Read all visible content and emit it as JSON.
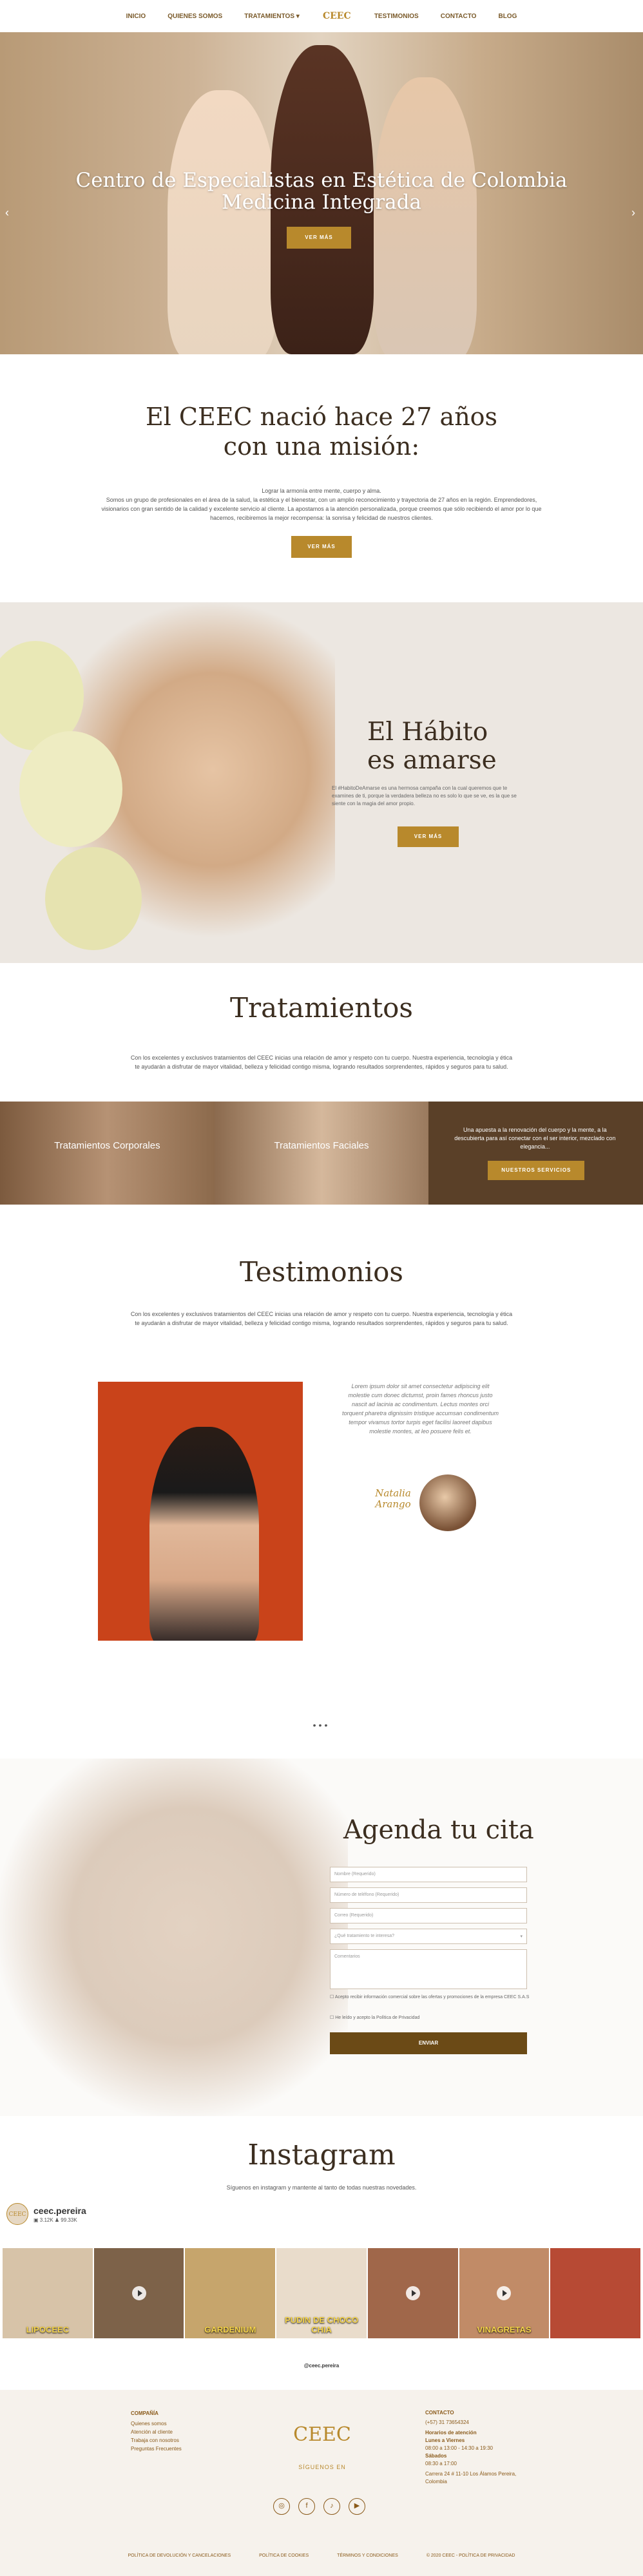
{
  "nav": {
    "items": [
      "INICIO",
      "QUIENES SOMOS",
      "TRATAMIENTOS",
      "TESTIMONIOS",
      "CONTACTO",
      "BLOG"
    ],
    "logo": "CEEC"
  },
  "hero": {
    "title_line1": "Centro de Especialistas en Estética de Colombia",
    "title_line2": "Medicina Integrada",
    "button": "VER MÁS"
  },
  "mission": {
    "title_line1": "El CEEC nació hace 27 años",
    "title_line2": "con una misión:",
    "p1": "Lograr la armonía entre mente, cuerpo y alma.",
    "p2": "Somos un grupo de profesionales en el área de la salud, la estética y el bienestar, con un amplio reconocimiento y trayectoria de 27 años en la región. Emprendedores, visionarios con gran sentido de la calidad y excelente servicio al cliente. La apostamos a la atención personalizada, porque creemos que sólo recibiendo el amor por lo que hacemos, recibiremos la mejor recompensa: la sonrisa y felicidad de nuestros clientes.",
    "button": "VER MÁS"
  },
  "habito": {
    "title_line1": "El Hábito",
    "title_line2": "es amarse",
    "text": "El #HabitoDeAmarse es una hermosa campaña con la cual queremos que te examines de ti, porque la verdadera belleza no es solo lo que se ve, es la que se siente con la magia del amor propio.",
    "button": "VER MÁS"
  },
  "tratamientos": {
    "title": "Tratamientos",
    "text": "Con los excelentes y exclusivos tratamientos del CEEC inicias una relación de amor y respeto con tu cuerpo. Nuestra experiencia, tecnología y ética te ayudarán a disfrutar de mayor vitalidad, belleza y felicidad contigo misma, logrando resultados sorprendentes, rápidos y seguros para tu salud.",
    "card1": "Tratamientos Corporales",
    "card2": "Tratamientos Faciales",
    "card3": "Una apuesta a la renovación del cuerpo y la mente, a la descubierta para así conectar con el ser interior, mezclado con elegancia...",
    "card3_button": "NUESTROS SERVICIOS"
  },
  "testimonios": {
    "title": "Testimonios",
    "text": "Con los excelentes y exclusivos tratamientos del CEEC inicias una relación de amor y respeto con tu cuerpo. Nuestra experiencia, tecnología y ética te ayudarán a disfrutar de mayor vitalidad, belleza y felicidad contigo misma, logrando resultados sorprendentes, rápidos y seguros para tu salud.",
    "quote": "Lorem ipsum dolor sit amet consectetur adipiscing elit molestie cum donec dictumst, proin fames rhoncus justo nascit ad lacinia ac condimentum. Lectus montes orci torquent pharetra dignissim tristique accumsan condimentum tempor vivamus tortor turpis eget facilisi laoreet dapibus molestie montes, at leo posuere felis et.",
    "name_line1": "Natalia",
    "name_line2": "Arango"
  },
  "agenda": {
    "title": "Agenda tu cita",
    "f1": "Nombre (Requerido)",
    "f2": "Número de teléfono (Requerido)",
    "f3": "Correo (Requerido)",
    "f4": "¿Qué tratamiento te interesa?",
    "f5": "Comentarios",
    "c1": "Acepto recibir información comercial sobre las ofertas y promociones de la empresa CEEC S.A.S",
    "c2": "He leído y acepto la Política de Privacidad",
    "button": "ENVIAR"
  },
  "instagram": {
    "title": "Instagram",
    "subtitle": "Síguenos en instagram y mantente al tanto de todas nuestras novedades.",
    "profile_name": "ceec.pereira",
    "stats": "▣ 3.12K   ♟ 99.33K",
    "handle": "@ceec.pereira",
    "tiles": [
      {
        "label": "LIPOCEEC",
        "color": "#d7c3a8"
      },
      {
        "label": "",
        "color": "#7d6249"
      },
      {
        "label": "GARDENIUM",
        "color": "#c6a56c"
      },
      {
        "label": "PUDIN DE CHOCO CHIA",
        "color": "#e9dccb"
      },
      {
        "label": "",
        "color": "#a0674a"
      },
      {
        "label": "VINAGRETAS",
        "color": "#c18b67"
      },
      {
        "label": "",
        "color": "#b74a34"
      }
    ]
  },
  "footer": {
    "company_heading": "COMPAÑÍA",
    "company_links": [
      "Quienes somos",
      "Atención al cliente",
      "Trabaja con nosotros",
      "Preguntas Frecuentes"
    ],
    "logo": "CEEC",
    "logo_sub": "SÍGUENOS EN",
    "contact_heading": "CONTACTO",
    "phone": "(+57) 31 73654324",
    "hours_heading": "Horarios de atención",
    "hours1": "Lunes a Viernes",
    "hours2": "08:00 a 13:00 - 14:30 a 19:30",
    "hours3": "Sábados",
    "hours4": "08:30 a 17:00",
    "address": "Carrera 24 # 11-10 Los Álamos Pereira, Colombia",
    "bottom_links": [
      "POLÍTICA DE DEVOLUCIÓN Y CANCELACIONES",
      "POLÍTICA DE COOKIES",
      "TÉRMINOS Y CONDICIONES",
      "© 2020 CEEC - POLÍTICA DE PRIVACIDAD"
    ]
  }
}
